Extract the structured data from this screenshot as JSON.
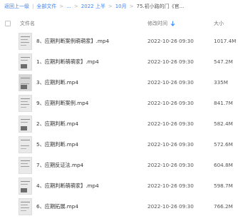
{
  "breadcrumb": {
    "back": "返回上一级",
    "all_files": "全部文件",
    "ellipsis": "...",
    "folder1": "2022 上半",
    "folder2": "10月",
    "current": "75.初小路的门《官..."
  },
  "table": {
    "col_name": "文件名",
    "col_time": "修改时间",
    "col_size": "大小",
    "sort_icon": "arrow-down-icon"
  },
  "files": [
    {
      "name": "8、应期判断案例萌萌家】.mp4",
      "time": "2022-10-26 09:30",
      "size": "1017.4M"
    },
    {
      "name": "1、应期判断萌萌家】.mp4",
      "time": "2022-10-26 09:30",
      "size": "547.2M"
    },
    {
      "name": "3、应期判断.mp4",
      "time": "2022-10-26 09:30",
      "size": "335M"
    },
    {
      "name": "9、应期判断案例.mp4",
      "time": "2022-10-26 09:30",
      "size": "841.7M"
    },
    {
      "name": "2、应期判断.mp4",
      "time": "2022-10-26 09:30",
      "size": "582.4M"
    },
    {
      "name": "5、应期判断.mp4",
      "time": "2022-10-26 09:30",
      "size": "572.6M"
    },
    {
      "name": "7、应期反证法.mp4",
      "time": "2022-10-26 09:30",
      "size": "604.8M"
    },
    {
      "name": "4、应期判断萌萌家】.mp4",
      "time": "2022-10-26 09:30",
      "size": "598.7M"
    },
    {
      "name": "6、应期拓展.mp4",
      "time": "2022-10-26 09:30",
      "size": "766.2M"
    }
  ]
}
